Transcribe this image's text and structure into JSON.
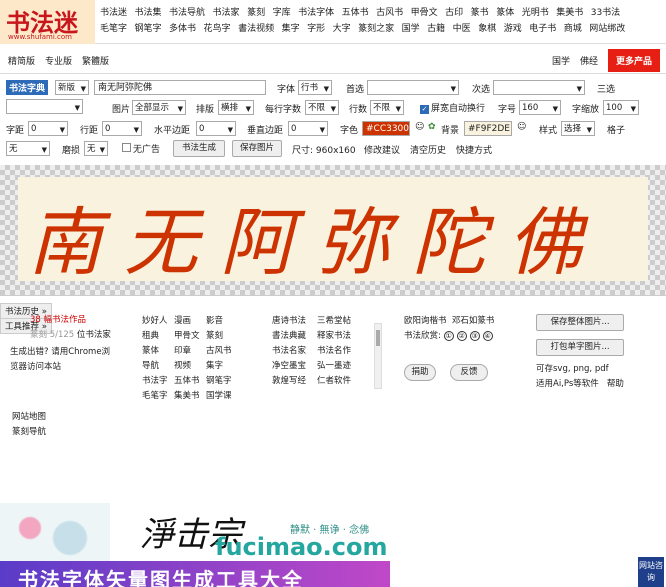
{
  "header": {
    "logo_text": "书法迷",
    "logo_url": "www.shufami.com",
    "nav_row1": [
      "书法迷",
      "书法集",
      "书法导航",
      "书法家",
      "篆刻",
      "字库",
      "书法字体",
      "五体书",
      "古风书",
      "甲骨文",
      "古印",
      "篆书",
      "篆体",
      "光明书",
      "集美书",
      "33书法"
    ],
    "nav_row2": [
      "毛笔字",
      "钢笔字",
      "多体书",
      "花鸟字",
      "書法视频",
      "集字",
      "字形",
      "大字",
      "篆刻之家",
      "国学",
      "古籍",
      "中医",
      "象棋",
      "游戏",
      "电子书",
      "商城",
      "网站绑改"
    ]
  },
  "subbar": {
    "versions": [
      "精简版",
      "专业版",
      "繁體版"
    ],
    "right_links": [
      "国学",
      "佛经"
    ],
    "more_products": "更多产品"
  },
  "form": {
    "dict_tag": "书法字典",
    "version_select": "新版",
    "text_value": "南无阿弥陀佛",
    "font_label": "字体",
    "font_select": "行书",
    "first_label": "首选",
    "second_label": "次选",
    "third_label": "三选",
    "image_label": "图片",
    "image_select": "全部显示",
    "layout_label": "排版",
    "layout_select": "横排",
    "per_row_label": "每行字数",
    "per_row_select": "不限",
    "rows_label": "行数",
    "rows_select": "不限",
    "wrap_label": "屏宽自动换行",
    "size_label": "字号",
    "size_value": "160",
    "zoom_label": "字缩放",
    "zoom_value": "100",
    "charspace_label": "字距",
    "charspace_value": "0",
    "linespace_label": "行距",
    "linespace_value": "0",
    "hmargin_label": "水平边距",
    "hmargin_value": "0",
    "vmargin_label": "垂直边距",
    "vmargin_value": "0",
    "color_label": "字色",
    "color_value": "#CC3300",
    "bg_label": "背景",
    "bg_value": "#F9F2DE",
    "style_label": "样式",
    "style_select": "选择",
    "grid_label": "格子",
    "grid_select": "无",
    "wear_label": "磨损",
    "wear_select": "无",
    "noad_label": "无广告",
    "generate_button": "书法生成",
    "save_button": "保存图片",
    "size_info": "尺寸: 960x160",
    "suggest_link": "修改建议",
    "clear_link": "清空历史",
    "shortcut_link": "快捷方式"
  },
  "preview": {
    "text": "南无阿弥陀佛"
  },
  "lower": {
    "history_tab": "书法历史 »",
    "tools_tab": "工具推荐 »",
    "col1": [
      "38 幅书法作品",
      "位书法家",
      "生成出错? 请用Chrome浏",
      "览器访问本站"
    ],
    "col1_prefix": "篆刻 5/125",
    "col2": [
      "妙好人",
      "漫画",
      "影音",
      "租典",
      "甲骨文",
      "篆刻",
      "篆体",
      "印章",
      "古风书",
      "导航",
      "视频",
      "集字",
      "书法字",
      "五体书",
      "钢笔字",
      "毛笔字",
      "集美书",
      "国学课"
    ],
    "col3": [
      "唐诗书法",
      "三希堂帖",
      "書法典藏",
      "释家书法",
      "书法名家",
      "书法名作",
      "净空墨宝",
      "弘一墨迹",
      "敦煌写经",
      "仁者软件"
    ],
    "col4_row1": [
      "欧阳询楷书",
      "邓石如篆书"
    ],
    "col4_label": "书法欣赏:",
    "col4_circles": [
      "①",
      "②",
      "③",
      "④"
    ],
    "donate": "捐助",
    "feedback": "反馈",
    "save_all": "保存整体图片...",
    "print_single": "打包单字图片...",
    "save_formats": "可存svg, png, pdf",
    "software": "适用Ai,Ps等软件",
    "help": "帮助",
    "sitemap": "网站地图",
    "seal_nav": "篆刻导航"
  },
  "banner": {
    "brush_text": "淨击宗",
    "slogan": "静默 · 無诤 · 念佛",
    "site": "fucimao.com",
    "strip_text": "书法字体矢量图生成工具大全"
  },
  "consult": "网站咨询"
}
